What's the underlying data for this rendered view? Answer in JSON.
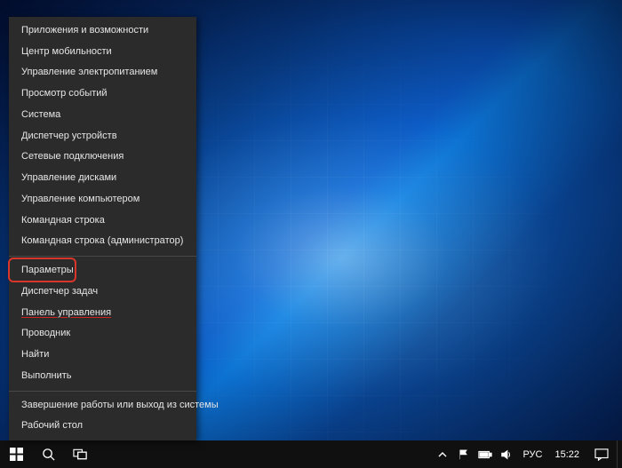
{
  "menu": {
    "groups": [
      [
        {
          "id": "apps-features",
          "label": "Приложения и возможности"
        },
        {
          "id": "mobility-center",
          "label": "Центр мобильности"
        },
        {
          "id": "power-options",
          "label": "Управление электропитанием"
        },
        {
          "id": "event-viewer",
          "label": "Просмотр событий"
        },
        {
          "id": "system",
          "label": "Система"
        },
        {
          "id": "device-manager",
          "label": "Диспетчер устройств"
        },
        {
          "id": "network-connections",
          "label": "Сетевые подключения"
        },
        {
          "id": "disk-management",
          "label": "Управление дисками"
        },
        {
          "id": "computer-management",
          "label": "Управление компьютером"
        },
        {
          "id": "command-prompt",
          "label": "Командная строка"
        },
        {
          "id": "command-prompt-admin",
          "label": "Командная строка (администратор)"
        }
      ],
      [
        {
          "id": "settings",
          "label": "Параметры",
          "highlightBox": true
        },
        {
          "id": "task-manager",
          "label": "Диспетчер задач"
        },
        {
          "id": "control-panel",
          "label": "Панель управления",
          "underline": true
        },
        {
          "id": "file-explorer",
          "label": "Проводник"
        },
        {
          "id": "search",
          "label": "Найти"
        },
        {
          "id": "run",
          "label": "Выполнить"
        }
      ],
      [
        {
          "id": "shutdown-signout",
          "label": "Завершение работы или выход из системы"
        },
        {
          "id": "desktop",
          "label": "Рабочий стол"
        }
      ]
    ]
  },
  "taskbar": {
    "language": "РУС",
    "clock": "15:22"
  }
}
